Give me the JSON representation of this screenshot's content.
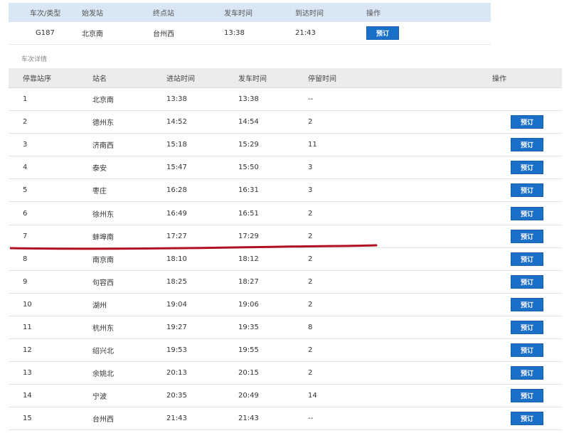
{
  "summary": {
    "headers": [
      "车次/类型",
      "始发站",
      "终点站",
      "发车时间",
      "到达时间",
      "操作"
    ],
    "row": {
      "train": "G187",
      "origin": "北京南",
      "destination": "台州西",
      "depart": "13:38",
      "arrive": "21:43",
      "button": "预订"
    }
  },
  "section_title": "车次详情",
  "detail": {
    "headers": [
      "停靠站序",
      "站名",
      "进站时间",
      "发车时间",
      "停留时间",
      "操作"
    ],
    "button_label": "预订",
    "rows": [
      {
        "seq": "1",
        "station": "北京南",
        "arrive": "13:38",
        "depart": "13:38",
        "stay": "--"
      },
      {
        "seq": "2",
        "station": "德州东",
        "arrive": "14:52",
        "depart": "14:54",
        "stay": "2"
      },
      {
        "seq": "3",
        "station": "济南西",
        "arrive": "15:18",
        "depart": "15:29",
        "stay": "11"
      },
      {
        "seq": "4",
        "station": "泰安",
        "arrive": "15:47",
        "depart": "15:50",
        "stay": "3"
      },
      {
        "seq": "5",
        "station": "枣庄",
        "arrive": "16:28",
        "depart": "16:31",
        "stay": "3"
      },
      {
        "seq": "6",
        "station": "徐州东",
        "arrive": "16:49",
        "depart": "16:51",
        "stay": "2"
      },
      {
        "seq": "7",
        "station": "蚌埠南",
        "arrive": "17:27",
        "depart": "17:29",
        "stay": "2"
      },
      {
        "seq": "8",
        "station": "南京南",
        "arrive": "18:10",
        "depart": "18:12",
        "stay": "2"
      },
      {
        "seq": "9",
        "station": "句容西",
        "arrive": "18:25",
        "depart": "18:27",
        "stay": "2"
      },
      {
        "seq": "10",
        "station": "湖州",
        "arrive": "19:04",
        "depart": "19:06",
        "stay": "2"
      },
      {
        "seq": "11",
        "station": "杭州东",
        "arrive": "19:27",
        "depart": "19:35",
        "stay": "8"
      },
      {
        "seq": "12",
        "station": "绍兴北",
        "arrive": "19:53",
        "depart": "19:55",
        "stay": "2"
      },
      {
        "seq": "13",
        "station": "余姚北",
        "arrive": "20:13",
        "depart": "20:15",
        "stay": "2"
      },
      {
        "seq": "14",
        "station": "宁波",
        "arrive": "20:35",
        "depart": "20:49",
        "stay": "14"
      },
      {
        "seq": "15",
        "station": "台州西",
        "arrive": "21:43",
        "depart": "21:43",
        "stay": "--"
      }
    ]
  },
  "colors": {
    "summary_header_bg": "#d9e6f4",
    "detail_header_bg": "#ececec",
    "button_bg": "#1a6fc9",
    "annotation_line": "#b01020"
  }
}
